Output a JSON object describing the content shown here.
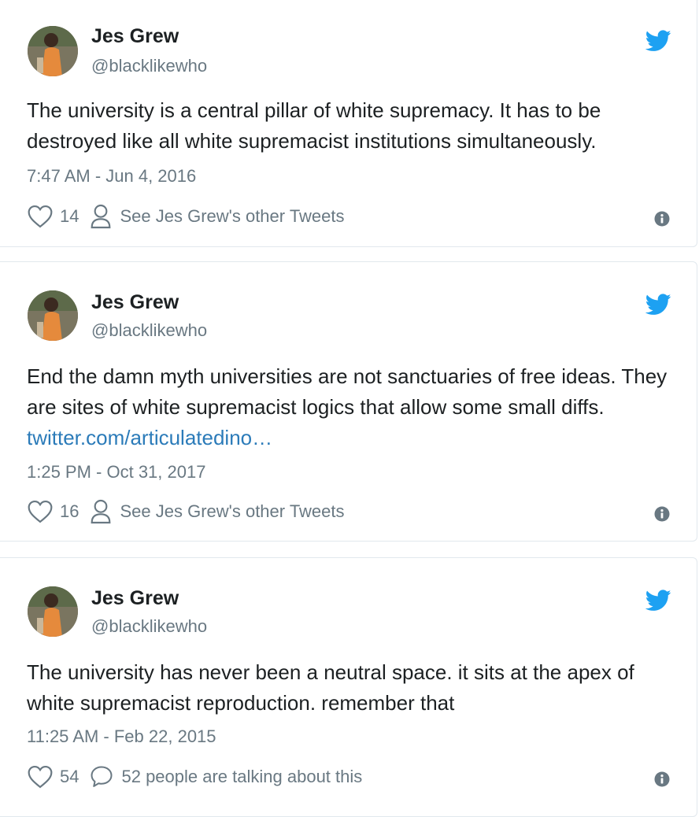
{
  "colors": {
    "text": "#1c2022",
    "secondary": "#697882",
    "link": "#2b7bb9",
    "twitter_blue": "#1da1f2",
    "border": "#e1e8ed"
  },
  "tweets": [
    {
      "author_name": "Jes Grew",
      "author_handle": "@blacklikewho",
      "text": "The university is a central pillar of white supremacy. It has to be destroyed like all white supremacist institutions simultaneously.",
      "link": "",
      "timestamp": "7:47 AM - Jun 4, 2016",
      "likes": "14",
      "secondary_action": "See Jes Grew's other Tweets",
      "secondary_icon": "person-icon"
    },
    {
      "author_name": "Jes Grew",
      "author_handle": "@blacklikewho",
      "text": "End the damn myth universities are not sanctuaries of free ideas. They are sites of white supremacist logics that allow some small diffs. ",
      "link": "twitter.com/articulatedino…",
      "timestamp": "1:25 PM - Oct 31, 2017",
      "likes": "16",
      "secondary_action": "See Jes Grew's other Tweets",
      "secondary_icon": "person-icon"
    },
    {
      "author_name": "Jes Grew",
      "author_handle": "@blacklikewho",
      "text": "The university has never been a neutral space. it sits at the apex of white supremacist reproduction. remember that",
      "link": "",
      "timestamp": "11:25 AM - Feb 22, 2015",
      "likes": "54",
      "secondary_action": "52 people are talking about this",
      "secondary_icon": "comment-bubble-icon"
    }
  ]
}
